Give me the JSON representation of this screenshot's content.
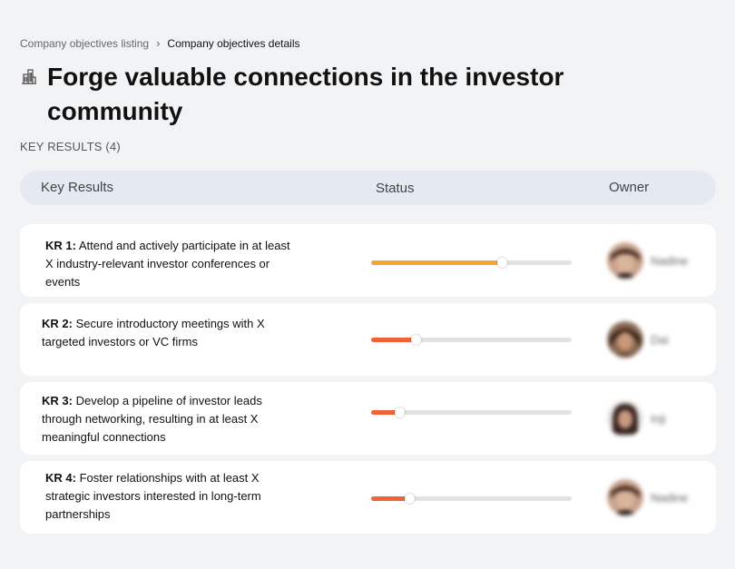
{
  "breadcrumb": {
    "parent": "Company objectives listing",
    "separator": "›",
    "current": "Company objectives details"
  },
  "page": {
    "icon": "building-icon",
    "title": "Forge valuable connections in the investor community"
  },
  "key_results": {
    "label": "KEY RESULTS (4)",
    "columns": [
      "Key Results",
      "Status",
      "Owner"
    ],
    "rows": [
      {
        "id": "KR 1:",
        "text": "Attend and actively participate in at least X industry-relevant investor conferences or events",
        "progress": 0.65,
        "color": "#f5a431",
        "owner": "Nadine"
      },
      {
        "id": "KR 2:",
        "text": "Secure introductory meetings with X targeted investors or VC firms",
        "progress": 0.22,
        "color": "#f06237",
        "owner": "Dai"
      },
      {
        "id": "KR 3:",
        "text": "Develop a pipeline of investor leads through networking, resulting in at least X meaningful connections",
        "progress": 0.14,
        "color": "#f06237",
        "owner": "Inji"
      },
      {
        "id": "KR 4:",
        "text": "Foster relationships with at least X strategic investors interested in long-term partnerships",
        "progress": 0.19,
        "color": "#f06237",
        "owner": "Nadine"
      }
    ]
  }
}
